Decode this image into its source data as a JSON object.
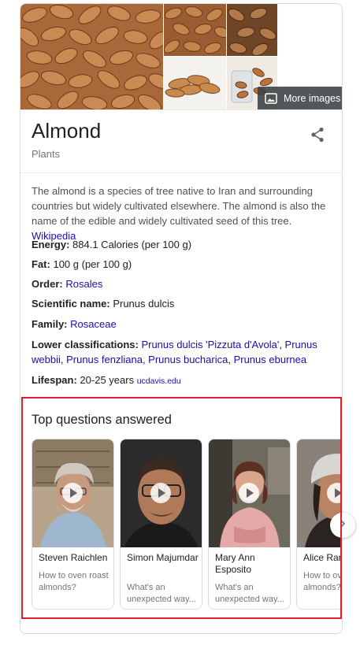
{
  "images": {
    "more_images_label": "More images"
  },
  "entity": {
    "title": "Almond",
    "subtitle": "Plants"
  },
  "description": {
    "text": "The almond is a species of tree native to Iran and surrounding countries but widely cultivated elsewhere. The almond is also the name of the edible and widely cultivated seed of this tree.",
    "source": "Wikipedia"
  },
  "facts": {
    "energy": {
      "label": "Energy:",
      "value": "884.1 Calories (per 100 g)"
    },
    "fat": {
      "label": "Fat:",
      "value": "100 g (per 100 g)"
    },
    "order": {
      "label": "Order:",
      "value": "Rosales"
    },
    "scientific_name": {
      "label": "Scientific name:",
      "value": "Prunus dulcis"
    },
    "family": {
      "label": "Family:",
      "value": "Rosaceae"
    },
    "lower_classifications": {
      "label": "Lower classifications:",
      "values": [
        "Prunus dulcis 'Pizzuta d'Avola'",
        "Prunus webbii",
        "Prunus fenzliana",
        "Prunus bucharica",
        "Prunus eburnea"
      ]
    },
    "lifespan": {
      "label": "Lifespan:",
      "value": "20-25 years",
      "source": "ucdavis.edu"
    }
  },
  "top_questions": {
    "title": "Top questions answered",
    "videos": [
      {
        "name": "Steven Raichlen",
        "question": "How to oven roast almonds?"
      },
      {
        "name": "Simon Majumdar",
        "question": "What's an unexpected way..."
      },
      {
        "name": "Mary Ann Esposito",
        "question": "What's an unexpected way..."
      },
      {
        "name": "Alice Ran",
        "question": "How to ov almonds?"
      }
    ]
  },
  "colors": {
    "link": "#1a0dab",
    "highlight": "#e21d2a"
  }
}
